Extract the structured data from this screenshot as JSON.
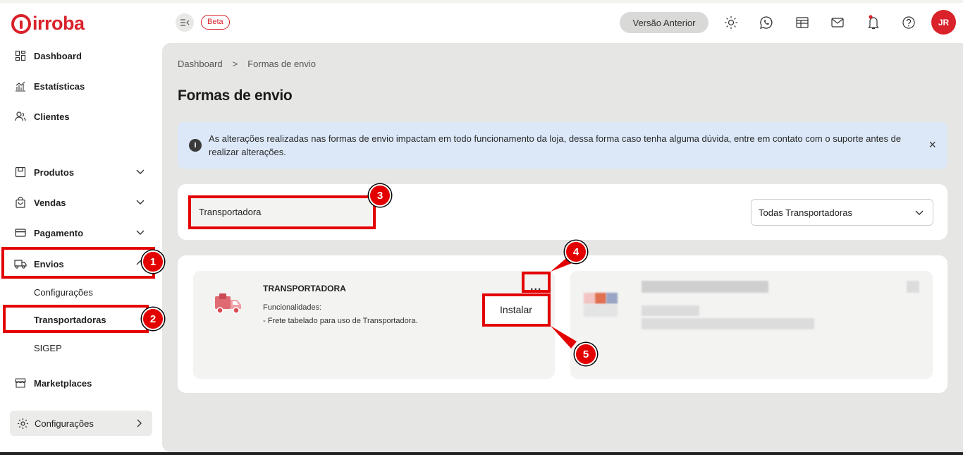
{
  "brand": {
    "name": "irroba",
    "color": "#d9222a"
  },
  "sidebar": {
    "items": [
      {
        "label": "Dashboard",
        "icon": "dashboard-icon"
      },
      {
        "label": "Estatísticas",
        "icon": "chart-icon"
      },
      {
        "label": "Clientes",
        "icon": "users-icon"
      },
      {
        "label": "Produtos",
        "icon": "box-icon"
      },
      {
        "label": "Vendas",
        "icon": "bag-icon"
      },
      {
        "label": "Pagamento",
        "icon": "card-icon"
      },
      {
        "label": "Envios",
        "icon": "truck-icon"
      },
      {
        "label": "Marketplaces",
        "icon": "store-icon"
      }
    ],
    "envios_sub": [
      "Configurações",
      "Transportadoras",
      "SIGEP"
    ],
    "config_label": "Configurações"
  },
  "header": {
    "beta": "Beta",
    "prev_version": "Versão Anterior",
    "avatar": "JR"
  },
  "breadcrumb": {
    "home": "Dashboard",
    "sep": ">",
    "current": "Formas de envio"
  },
  "page_title": "Formas de envio",
  "alert": {
    "message": "As alterações realizadas nas formas de envio impactam em todo funcionamento da loja, dessa forma caso tenha alguma dúvida, entre em contato com o suporte antes de realizar alterações.",
    "close": "×"
  },
  "filter": {
    "search_value": "Transportadora",
    "select_value": "Todas Transportadoras"
  },
  "card": {
    "title": "TRANSPORTADORA",
    "func_label": "Funcionalidades:",
    "description": "- Frete tabelado para uso de Transportadora.",
    "menu": "...",
    "install": "Instalar"
  },
  "annotations": [
    "1",
    "2",
    "3",
    "4",
    "5"
  ],
  "colors": {
    "annotation": "#e30000",
    "main_bg": "#e6e6e4",
    "alert_bg": "#dce8f8"
  }
}
